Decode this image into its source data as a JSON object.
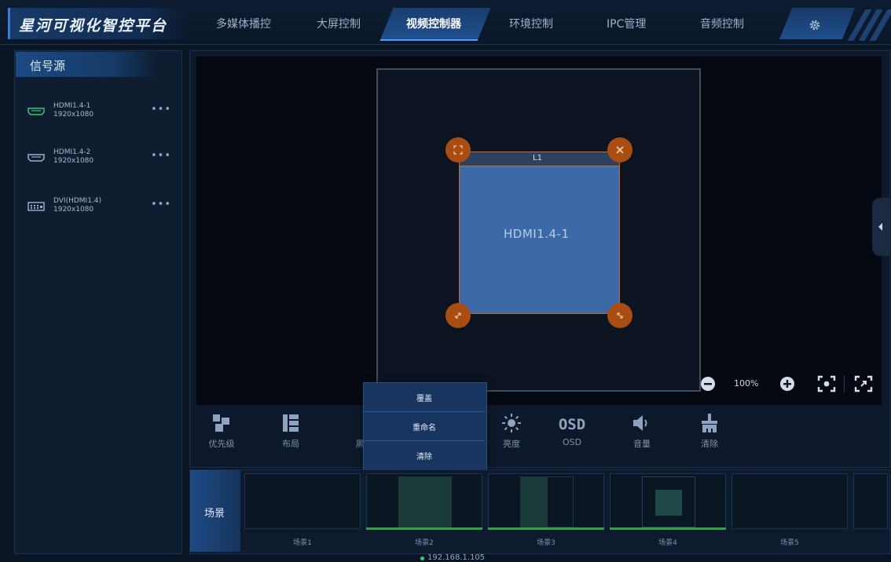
{
  "app": {
    "title": "星河可视化智控平台"
  },
  "nav": {
    "items": [
      {
        "label": "多媒体播控"
      },
      {
        "label": "大屏控制"
      },
      {
        "label": "视频控制器"
      },
      {
        "label": "环境控制"
      },
      {
        "label": "IPC管理"
      },
      {
        "label": "音频控制"
      }
    ],
    "active_index": 2,
    "settings_icon": "gear-icon"
  },
  "sidebar": {
    "title": "信号源",
    "sources": [
      {
        "name": "HDMI1.4-1",
        "resolution": "1920x1080",
        "icon": "hdmi-port-icon",
        "status_color": "#2ecc71",
        "more": "•••"
      },
      {
        "name": "HDMI1.4-2",
        "resolution": "1920x1080",
        "icon": "hdmi-port-icon",
        "status_color": "#9fb1c8",
        "more": "•••"
      },
      {
        "name": "DVI(HDMI1.4)",
        "resolution": "1920x1080",
        "icon": "dvi-port-icon",
        "status_color": "#9fb1c8",
        "more": "•••"
      }
    ]
  },
  "canvas": {
    "window": {
      "label": "L1",
      "source": "HDMI1.4-1"
    },
    "zoom": "100%"
  },
  "toolbar": {
    "items": [
      {
        "label": "优先级",
        "icon": "priority-icon"
      },
      {
        "label": "布局",
        "icon": "layout-icon"
      },
      {
        "label": "黑",
        "icon": "black-screen-icon"
      },
      {
        "label": "",
        "icon": "hidden-icon"
      },
      {
        "label": "亮度",
        "icon": "brightness-icon"
      },
      {
        "label": "OSD",
        "icon": "osd-icon",
        "icon_text": "OSD"
      },
      {
        "label": "音量",
        "icon": "volume-icon"
      },
      {
        "label": "清除",
        "icon": "clear-icon"
      }
    ]
  },
  "context_menu": {
    "items": [
      {
        "label": "覆盖"
      },
      {
        "label": "重命名"
      },
      {
        "label": "清除"
      }
    ]
  },
  "scenes": {
    "title": "场景",
    "items": [
      {
        "label": "场景1",
        "active": false
      },
      {
        "label": "场景2",
        "active": true
      },
      {
        "label": "场景3",
        "active": true
      },
      {
        "label": "场景4",
        "active": true
      },
      {
        "label": "场景5",
        "active": false
      }
    ]
  },
  "status": {
    "ip": "192.168.1.105"
  },
  "colors": {
    "accent": "#3c6aa8",
    "handle": "#a94d12",
    "online": "#2ecc71",
    "scene_active": "#2ea04a"
  }
}
